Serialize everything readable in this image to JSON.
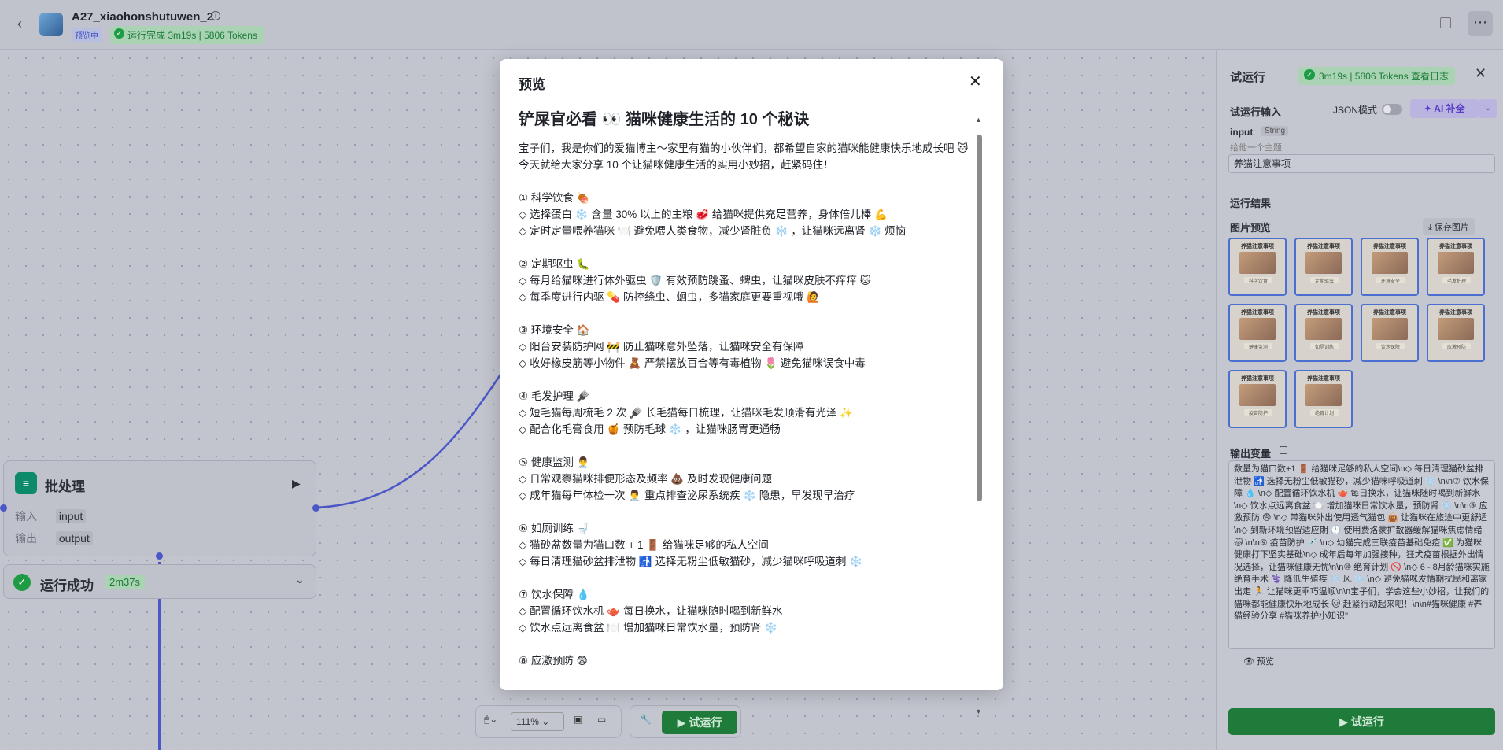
{
  "topbar": {
    "title": "A27_xiaohonshutuwen_2",
    "status_badge": "预览中",
    "run_badge": "运行完成 3m19s | 5806 Tokens"
  },
  "nodes": {
    "batch": {
      "title": "批处理",
      "input_label": "输入",
      "input_value": "input",
      "output_label": "输出",
      "output_value": "output"
    },
    "success": {
      "title": "运行成功",
      "time": "2m37s"
    }
  },
  "toolbar": {
    "zoom": "111%",
    "run_label": "试运行"
  },
  "panel": {
    "title": "试运行",
    "badge": "3m19s | 5806 Tokens  查看日志",
    "input_section": "试运行输入",
    "json_mode": "JSON模式",
    "ai_button": "AI 补全",
    "input_name": "input",
    "input_type": "String",
    "input_desc": "给他一个主题",
    "input_value": "养猫注意事项",
    "result_section": "运行结果",
    "image_preview": "图片预览",
    "save_image": "保存图片",
    "thumbnails": [
      {
        "title": "养猫注意事项",
        "caption": "科学饮食"
      },
      {
        "title": "养猫注意事项",
        "caption": "定期驱虫"
      },
      {
        "title": "养猫注意事项",
        "caption": "环境安全"
      },
      {
        "title": "养猫注意事项",
        "caption": "毛发护理"
      },
      {
        "title": "养猫注意事项",
        "caption": "健康监测"
      },
      {
        "title": "养猫注意事项",
        "caption": "如厕训练"
      },
      {
        "title": "养猫注意事项",
        "caption": "饮水保障"
      },
      {
        "title": "养猫注意事项",
        "caption": "应激预防"
      },
      {
        "title": "养猫注意事项",
        "caption": "疫苗防护"
      },
      {
        "title": "养猫注意事项",
        "caption": "绝育计划"
      }
    ],
    "output_label": "输出变量",
    "output_text": "数量为猫口数+1 🚪 给猫咪足够的私人空间\\n◇ 每日清理猫砂盆排泄物 🚮 选择无粉尘低敏猫砂，减少猫咪呼吸道刺 ❄️ \\n\\n⑦ 饮水保障 💧 \\n◇ 配置循环饮水机 🫖 每日换水，让猫咪随时喝到新鲜水\\n◇ 饮水点远离食盆 🍽️ 增加猫咪日常饮水量，预防肾 ❄️ \\n\\n⑧ 应激预防 😨 \\n◇ 带猫咪外出使用透气猫包 👜 让猫咪在旅途中更舒适\\n◇ 到新环境预留适应期 🕒 使用费洛蒙扩散器缓解猫咪焦虑情绪 🐱 \\n\\n⑨ 疫苗防护 💉 \\n◇ 幼猫完成三联疫苗基础免疫 ✅ 为猫咪健康打下坚实基础\\n◇ 成年后每年加强接种，狂犬疫苗根据外出情况选择，让猫咪健康无忧\\n\\n⑩ 绝育计划 🚫 \\n◇ 6 - 8月龄猫咪实施绝育手术 ⚕️ 降低生殖疾 ❄️ 风 ❄️ \\n◇ 避免猫咪发情期扰民和离家出走 🏃 让猫咪更乖巧温顺\\n\\n宝子们，学会这些小妙招，让我们的猫咪都能健康快乐地成长 🐱 赶紧行动起来吧！\\n\\n#猫咪健康 #养猫经验分享 #猫咪养护小知识\"",
    "preview_label": "预览",
    "run_button": "试运行"
  },
  "modal": {
    "title": "预览",
    "heading": "铲屎官必看 👀 猫咪健康生活的 10 个秘诀",
    "intro": "宝子们，我是你们的爱猫博主～家里有猫的小伙伴们，都希望自家的猫咪能健康快乐地成长吧 🐱 今天就给大家分享 10 个让猫咪健康生活的实用小妙招，赶紧码住！",
    "sections": [
      "① 科学饮食 🍖\n◇ 选择蛋白 ❄️ 含量 30% 以上的主粮 🥩 给猫咪提供充足营养，身体倍儿棒 💪\n◇ 定时定量喂养猫咪 🍽️ 避免喂人类食物，减少肾脏负 ❄️ ，让猫咪远离肾 ❄️ 烦恼",
      "② 定期驱虫 🐛\n◇ 每月给猫咪进行体外驱虫 🛡️ 有效预防跳蚤、蜱虫，让猫咪皮肤不痒痒 🐱\n◇ 每季度进行内驱 💊 防控绦虫、蛔虫，多猫家庭更要重视哦 🙋",
      "③ 环境安全 🏠\n◇ 阳台安装防护网 🚧 防止猫咪意外坠落，让猫咪安全有保障\n◇ 收好橡皮筋等小物件 🧸 严禁摆放百合等有毒植物 🌷 避免猫咪误食中毒",
      "④ 毛发护理 🪮\n◇ 短毛猫每周梳毛 2 次 🪮 长毛猫每日梳理，让猫咪毛发顺滑有光泽 ✨\n◇ 配合化毛膏食用 🍯 预防毛球 ❄️ ，让猫咪肠胃更通畅",
      "⑤ 健康监测 👨‍⚕️\n◇ 日常观察猫咪排便形态及频率 💩 及时发现健康问题\n◇ 成年猫每年体检一次 👨‍⚕️ 重点排查泌尿系统疾 ❄️ 隐患，早发现早治疗",
      "⑥ 如厕训练 🚽\n◇ 猫砂盆数量为猫口数 + 1 🚪 给猫咪足够的私人空间\n◇ 每日清理猫砂盆排泄物 🚮 选择无粉尘低敏猫砂，减少猫咪呼吸道刺 ❄️",
      "⑦ 饮水保障 💧\n◇ 配置循环饮水机 🫖 每日换水，让猫咪随时喝到新鲜水\n◇ 饮水点远离食盆 🍽️ 增加猫咪日常饮水量，预防肾 ❄️",
      "⑧ 应激预防 😨"
    ]
  }
}
